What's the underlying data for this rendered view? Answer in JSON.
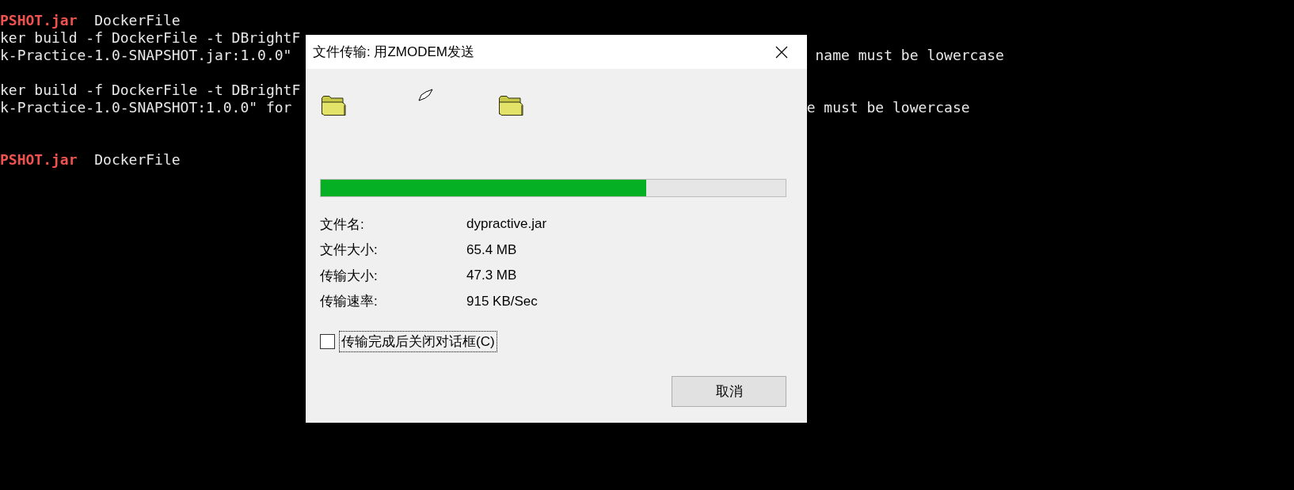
{
  "terminal": {
    "lines": [
      {
        "kind": "text",
        "segments": [
          {
            "text": "PSHOT.jar",
            "kind": "archive"
          },
          {
            "text": "DockerFile",
            "kind": "plain"
          }
        ]
      },
      {
        "kind": "text",
        "segments": [
          {
            "text": "ker build -f DockerFile -t DBrightF",
            "kind": "plain"
          }
        ]
      },
      {
        "kind": "text",
        "segments": [
          {
            "text": "k-Practice-1.0-SNAPSHOT.jar:1.0.0\"",
            "kind": "plain"
          }
        ],
        "tail": "name must be lowercase"
      },
      {
        "kind": "blank"
      },
      {
        "kind": "text",
        "segments": [
          {
            "text": "ker build -f DockerFile -t DBrightF",
            "kind": "plain"
          }
        ]
      },
      {
        "kind": "text",
        "segments": [
          {
            "text": "k-Practice-1.0-SNAPSHOT:1.0.0\" for",
            "kind": "plain"
          }
        ],
        "tail": "e must be lowercase"
      },
      {
        "kind": "blank"
      },
      {
        "kind": "blank"
      },
      {
        "kind": "text",
        "segments": [
          {
            "text": "PSHOT.jar",
            "kind": "archive"
          },
          {
            "text": "DockerFile",
            "kind": "plain"
          }
        ]
      }
    ]
  },
  "dialog": {
    "title": "文件传输: 用ZMODEM发送",
    "progress": {
      "level": 0.7
    },
    "fields": [
      {
        "label": "文件名:",
        "value": "dypractive.jar"
      },
      {
        "label": "文件大小:",
        "value": "65.4 MB"
      },
      {
        "label": "传输大小:",
        "value": "47.3 MB"
      },
      {
        "label": "传输速率:",
        "value": "915 KB/Sec"
      }
    ],
    "close_option": {
      "label": "传输完成后关闭对话框(C)",
      "checked": false,
      "focused": true
    },
    "buttons": [
      "取消"
    ]
  }
}
